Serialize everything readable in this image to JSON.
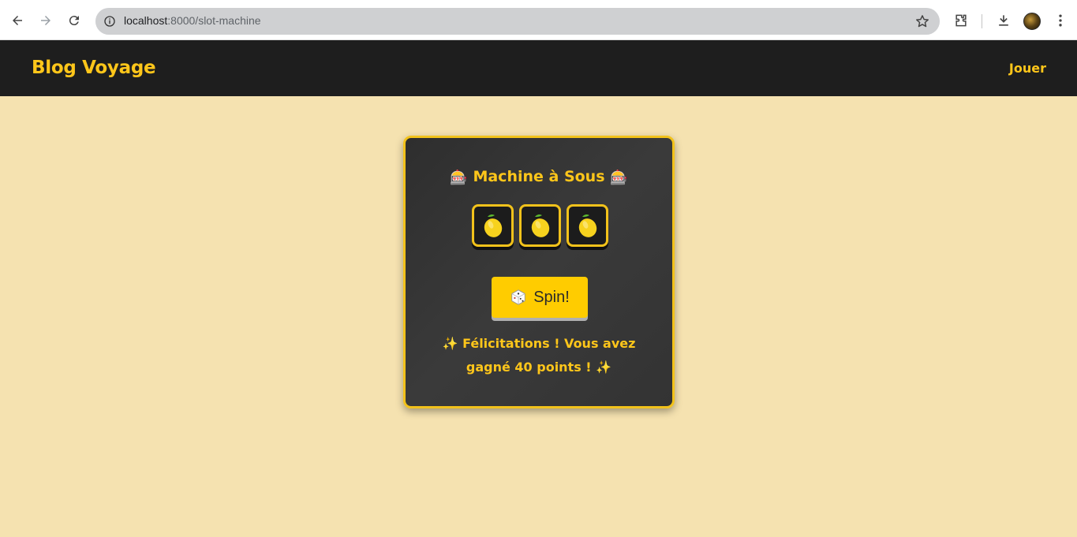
{
  "browser": {
    "url_host": "localhost",
    "url_path": ":8000/slot-machine",
    "icons": [
      "back-icon",
      "forward-icon",
      "reload-icon",
      "site-info-icon",
      "bookmark-star-icon",
      "extensions-icon",
      "download-icon",
      "profile-avatar",
      "menu-dots-icon"
    ]
  },
  "header": {
    "brand": "Blog Voyage",
    "nav_link": "Jouer"
  },
  "slot_machine": {
    "title_icon": "🎰",
    "title": "Machine à Sous",
    "reels": [
      "lemon",
      "lemon",
      "lemon"
    ],
    "spin_label": "Spin!",
    "spin_icon": "🎲",
    "result_icon": "✨",
    "result_text": "Félicitations ! Vous avez gagné 40 points !"
  },
  "colors": {
    "accent": "#ffc61a",
    "page_bg": "#f5e2b0",
    "header_bg": "#1e1e1e",
    "card_bg": "#333333"
  }
}
